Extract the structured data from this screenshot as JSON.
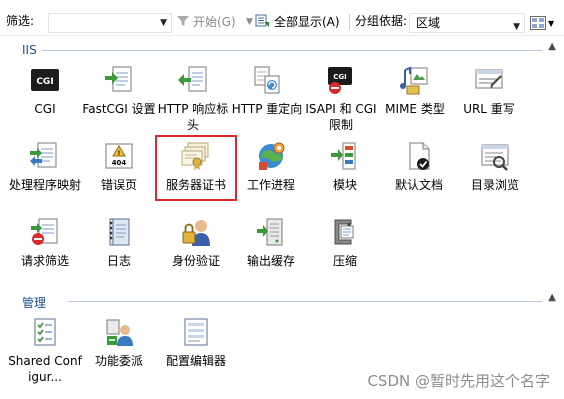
{
  "toolbar": {
    "filter_label": "筛选:",
    "filter_value": "",
    "start_label": "开始(G)",
    "show_all_label": "全部显示(A)",
    "group_by_label": "分组依据:",
    "group_by_value": "区域"
  },
  "sections": {
    "iis": {
      "title": "IIS",
      "items": [
        {
          "label": "CGI",
          "icon": "cgi-icon"
        },
        {
          "label": "FastCGI 设置",
          "icon": "fastcgi-settings-icon"
        },
        {
          "label": "HTTP 响应标头",
          "icon": "http-response-headers-icon"
        },
        {
          "label": "HTTP 重定向",
          "icon": "http-redirect-icon"
        },
        {
          "label": "ISAPI 和 CGI 限制",
          "icon": "isapi-cgi-restrictions-icon"
        },
        {
          "label": "MIME 类型",
          "icon": "mime-types-icon"
        },
        {
          "label": "URL 重写",
          "icon": "url-rewrite-icon"
        },
        {
          "label": "处理程序映射",
          "icon": "handler-mappings-icon"
        },
        {
          "label": "错误页",
          "icon": "error-pages-icon"
        },
        {
          "label": "服务器证书",
          "icon": "server-certificates-icon"
        },
        {
          "label": "工作进程",
          "icon": "worker-processes-icon"
        },
        {
          "label": "模块",
          "icon": "modules-icon"
        },
        {
          "label": "默认文档",
          "icon": "default-document-icon"
        },
        {
          "label": "目录浏览",
          "icon": "directory-browsing-icon"
        },
        {
          "label": "请求筛选",
          "icon": "request-filtering-icon"
        },
        {
          "label": "日志",
          "icon": "logging-icon"
        },
        {
          "label": "身份验证",
          "icon": "authentication-icon"
        },
        {
          "label": "输出缓存",
          "icon": "output-caching-icon"
        },
        {
          "label": "压缩",
          "icon": "compression-icon"
        }
      ]
    },
    "management": {
      "title": "管理",
      "items": [
        {
          "label": "Shared Configur...",
          "icon": "shared-configuration-icon"
        },
        {
          "label": "功能委派",
          "icon": "feature-delegation-icon"
        },
        {
          "label": "配置编辑器",
          "icon": "configuration-editor-icon"
        }
      ]
    }
  },
  "watermark": "CSDN @暂时先用这个名字",
  "colors": {
    "section_title": "#1f4e8c",
    "highlight_border": "#e0262b"
  }
}
